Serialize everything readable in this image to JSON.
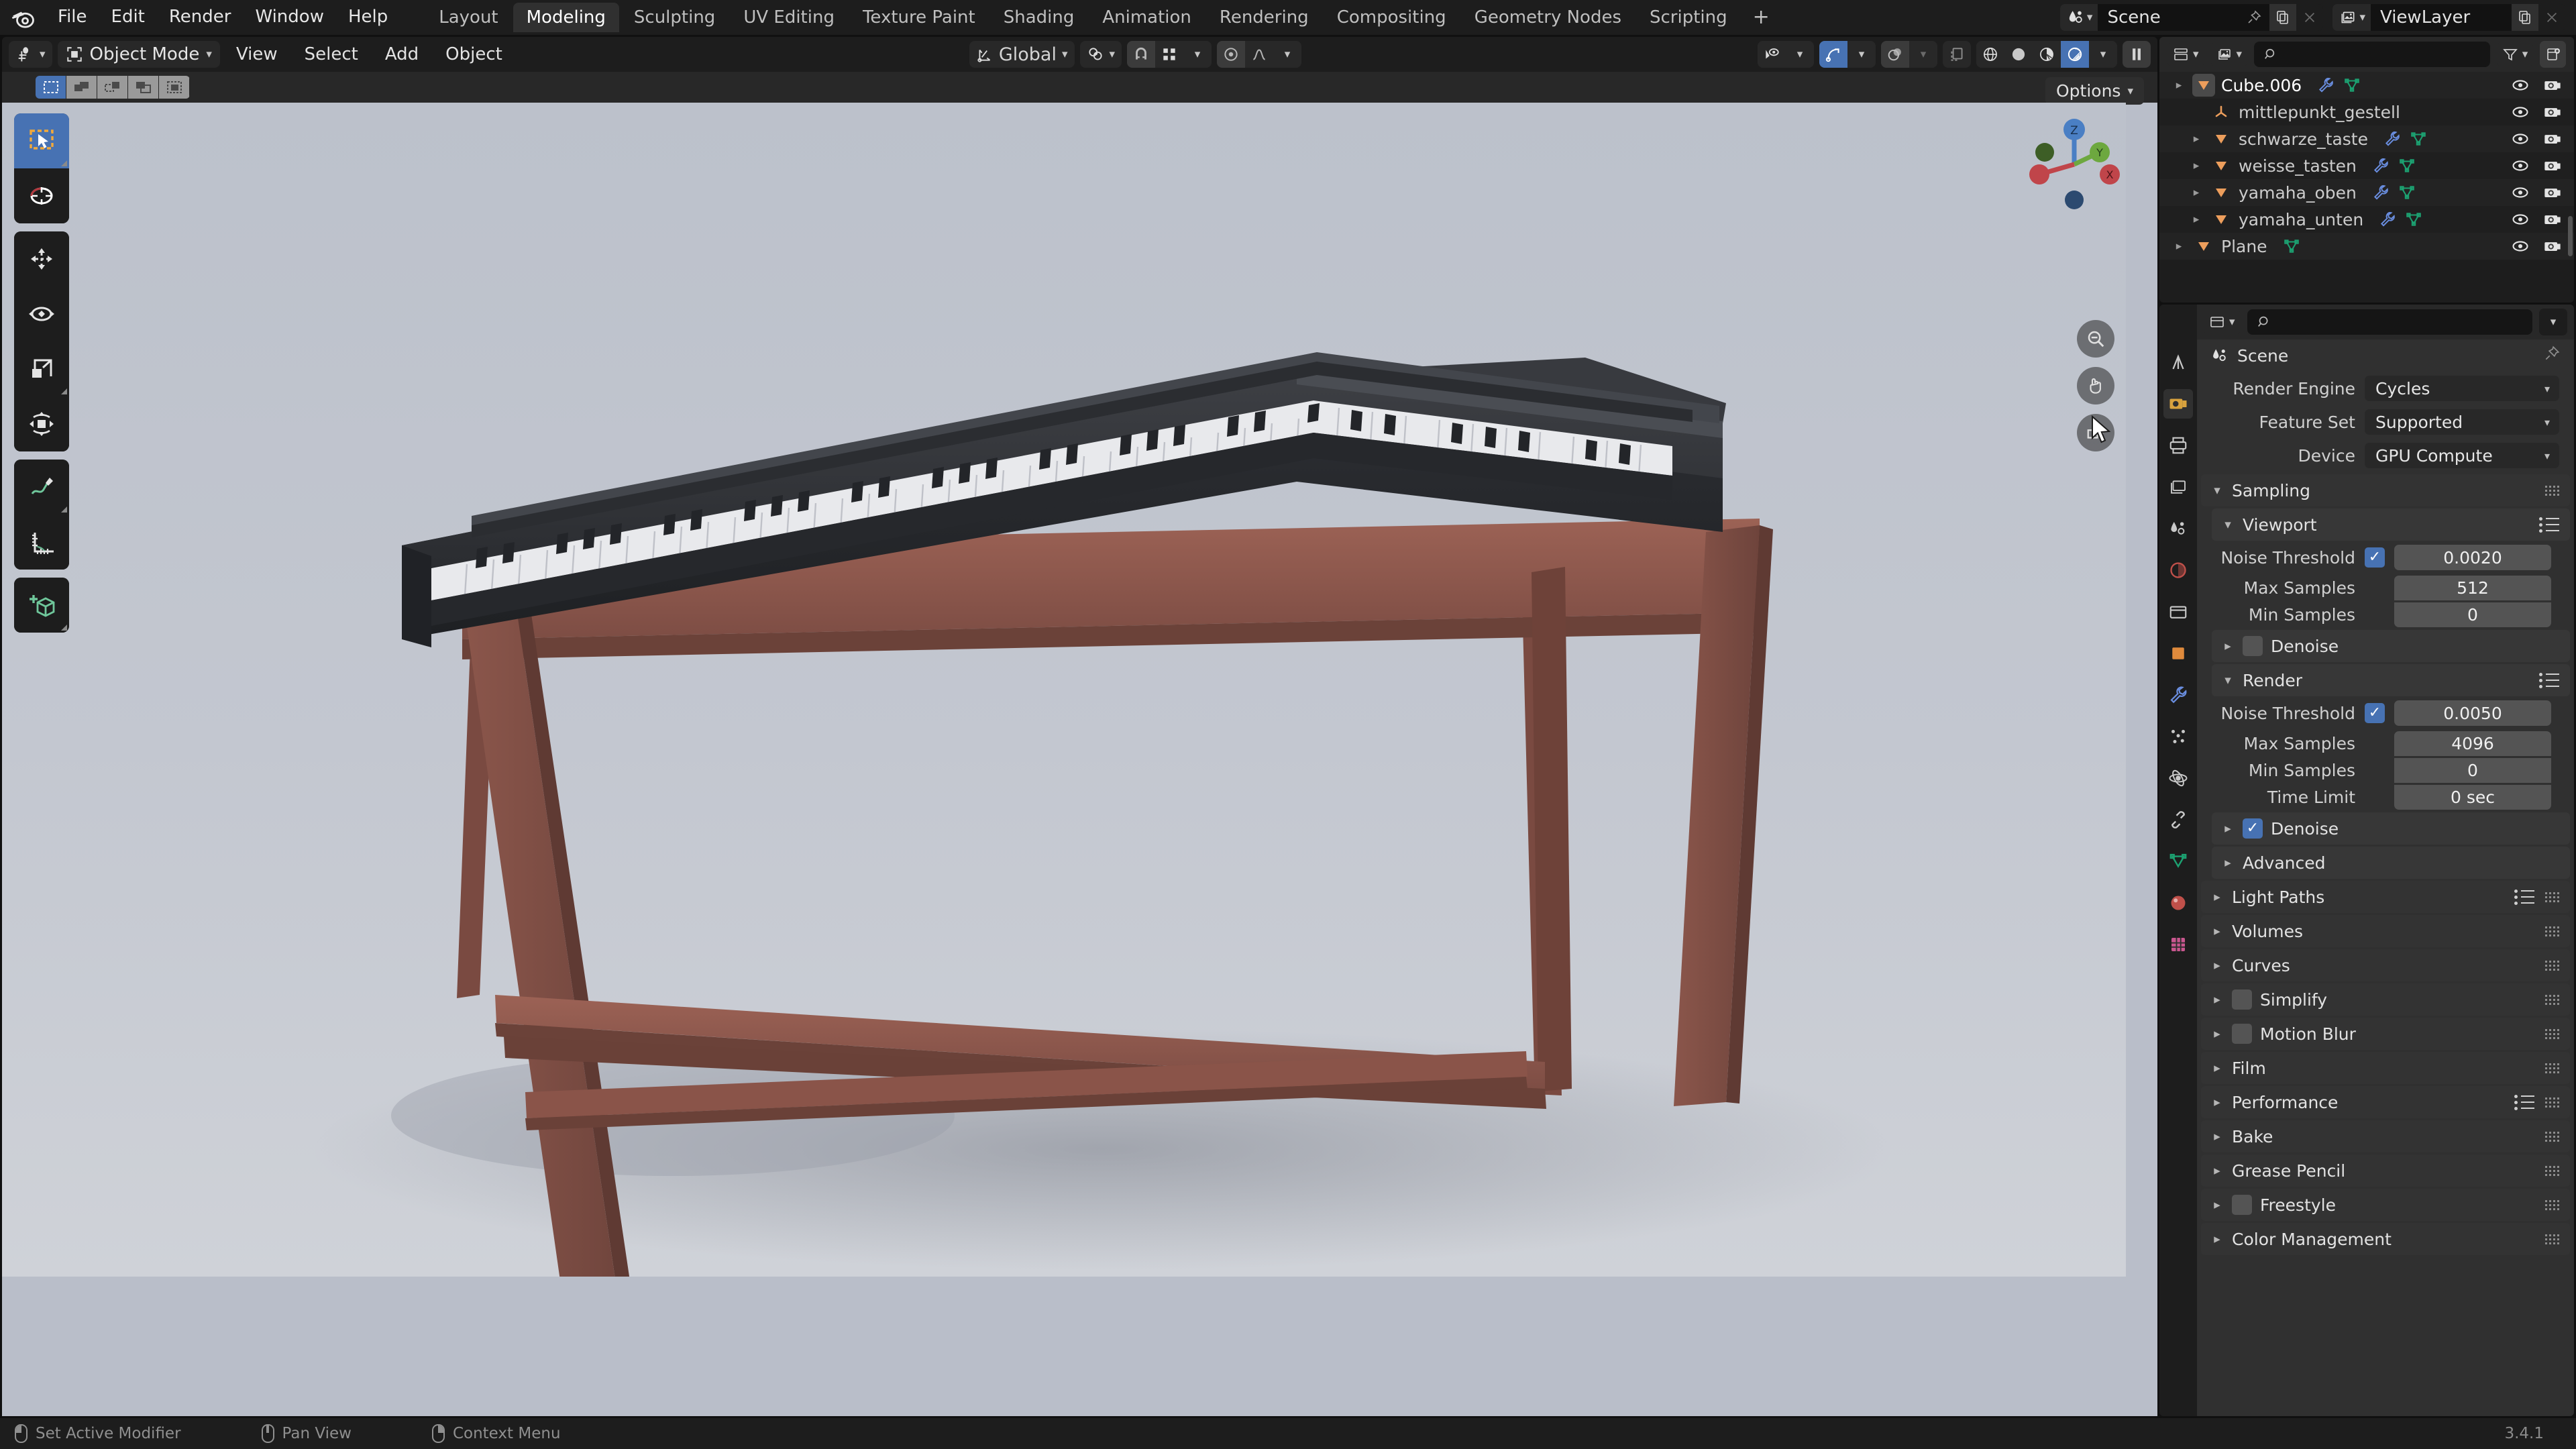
{
  "app": {
    "name": "Blender",
    "version": "3.4.1"
  },
  "topbar": {
    "menus": [
      "File",
      "Edit",
      "Render",
      "Window",
      "Help"
    ],
    "workspaces": [
      {
        "label": "Layout",
        "active": false
      },
      {
        "label": "Modeling",
        "active": true
      },
      {
        "label": "Sculpting",
        "active": false
      },
      {
        "label": "UV Editing",
        "active": false
      },
      {
        "label": "Texture Paint",
        "active": false
      },
      {
        "label": "Shading",
        "active": false
      },
      {
        "label": "Animation",
        "active": false
      },
      {
        "label": "Rendering",
        "active": false
      },
      {
        "label": "Compositing",
        "active": false
      },
      {
        "label": "Geometry Nodes",
        "active": false
      },
      {
        "label": "Scripting",
        "active": false
      }
    ],
    "add_workspace_label": "+",
    "scene_name": "Scene",
    "viewlayer_name": "ViewLayer"
  },
  "viewport_header": {
    "mode": "Object Mode",
    "menus": [
      "View",
      "Select",
      "Add",
      "Object"
    ],
    "transform_orientation": "Global",
    "options_label": "Options"
  },
  "outliner": {
    "search_placeholder": "",
    "search_value": "",
    "rows": [
      {
        "name": "Cube.006",
        "indent": 0,
        "disclosure": true,
        "active": true,
        "modifier": true,
        "mesh": true
      },
      {
        "name": "mittlepunkt_gestell",
        "indent": 1,
        "disclosure": false,
        "active": false,
        "modifier": false,
        "mesh": false
      },
      {
        "name": "schwarze_taste",
        "indent": 1,
        "disclosure": true,
        "active": false,
        "modifier": true,
        "mesh": true
      },
      {
        "name": "weisse_tasten",
        "indent": 1,
        "disclosure": true,
        "active": false,
        "modifier": true,
        "mesh": true
      },
      {
        "name": "yamaha_oben",
        "indent": 1,
        "disclosure": true,
        "active": false,
        "modifier": true,
        "mesh": true
      },
      {
        "name": "yamaha_unten",
        "indent": 1,
        "disclosure": true,
        "active": false,
        "modifier": true,
        "mesh": true
      },
      {
        "name": "Plane",
        "indent": 0,
        "disclosure": true,
        "active": false,
        "modifier": false,
        "mesh": true
      }
    ]
  },
  "properties": {
    "search_placeholder": "",
    "search_value": "",
    "breadcrumb": "Scene",
    "fields": [
      {
        "label": "Render Engine",
        "value": "Cycles"
      },
      {
        "label": "Feature Set",
        "value": "Supported"
      },
      {
        "label": "Device",
        "value": "GPU Compute"
      }
    ],
    "sampling": {
      "title": "Sampling",
      "open": true,
      "viewport": {
        "title": "Viewport",
        "open": true,
        "noise_threshold_label": "Noise Threshold",
        "noise_threshold_enabled": true,
        "noise_threshold_value": "0.0020",
        "max_samples_label": "Max Samples",
        "max_samples_value": "512",
        "min_samples_label": "Min Samples",
        "min_samples_value": "0",
        "denoise_label": "Denoise",
        "denoise_enabled": false
      },
      "render": {
        "title": "Render",
        "open": true,
        "noise_threshold_label": "Noise Threshold",
        "noise_threshold_enabled": true,
        "noise_threshold_value": "0.0050",
        "max_samples_label": "Max Samples",
        "max_samples_value": "4096",
        "min_samples_label": "Min Samples",
        "min_samples_value": "0",
        "time_limit_label": "Time Limit",
        "time_limit_value": "0 sec",
        "denoise_label": "Denoise",
        "denoise_enabled": true
      },
      "advanced_label": "Advanced"
    },
    "panels": [
      {
        "label": "Light Paths",
        "checkbox": null,
        "list_icon": true
      },
      {
        "label": "Volumes",
        "checkbox": null,
        "list_icon": false
      },
      {
        "label": "Curves",
        "checkbox": null,
        "list_icon": false
      },
      {
        "label": "Simplify",
        "checkbox": false,
        "list_icon": false
      },
      {
        "label": "Motion Blur",
        "checkbox": false,
        "list_icon": false
      },
      {
        "label": "Film",
        "checkbox": null,
        "list_icon": false
      },
      {
        "label": "Performance",
        "checkbox": null,
        "list_icon": true
      },
      {
        "label": "Bake",
        "checkbox": null,
        "list_icon": false
      },
      {
        "label": "Grease Pencil",
        "checkbox": null,
        "list_icon": false
      },
      {
        "label": "Freestyle",
        "checkbox": false,
        "list_icon": false
      },
      {
        "label": "Color Management",
        "checkbox": null,
        "list_icon": false
      }
    ]
  },
  "statusbar": {
    "items": [
      {
        "mouse": "left",
        "label": "Set Active Modifier"
      },
      {
        "mouse": "middle",
        "label": "Pan View"
      },
      {
        "mouse": "right",
        "label": "Context Menu"
      }
    ],
    "version": "3.4.1"
  },
  "colors": {
    "accent_blue": "#4772b3",
    "header_dark": "#1d1d1d",
    "panel_bg": "#303030",
    "viewport_bg": "#b9bec9",
    "mesh_orange": "#ed9e5c",
    "mesh_green": "#1ca171",
    "modifier_blue": "#6a8ee0"
  },
  "gizmo": {
    "axes": [
      "X",
      "Y",
      "Z"
    ]
  }
}
